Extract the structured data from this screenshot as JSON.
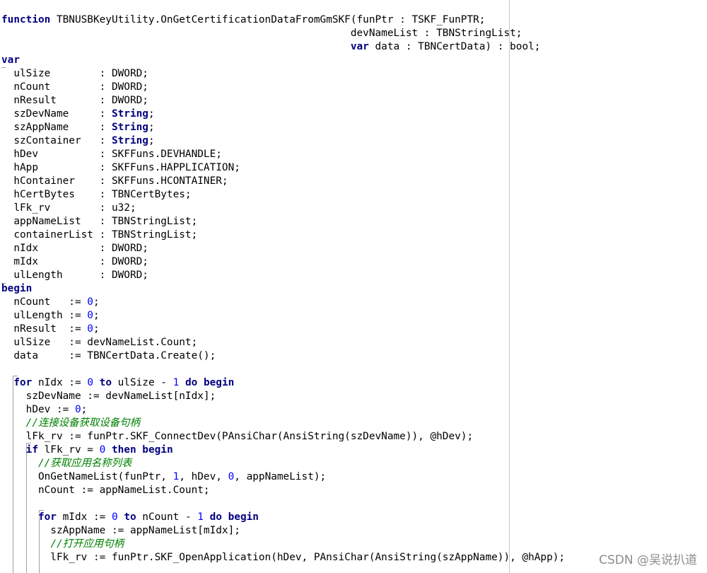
{
  "colors": {
    "keyword": "#000080",
    "number": "#0000ff",
    "comment": "#008000",
    "text": "#000000",
    "background": "#ffffff"
  },
  "watermark": "CSDN @吴说扒道",
  "code_lines": [
    [
      [
        "kw",
        "function"
      ],
      [
        "txt",
        " TBNUSBKeyUtility.OnGetCertificationDataFromGmSKF(funPtr : TSKF_FunPTR;"
      ]
    ],
    [
      [
        "txt",
        "                                                         devNameList : TBNStringList;"
      ]
    ],
    [
      [
        "txt",
        "                                                         "
      ],
      [
        "kw",
        "var"
      ],
      [
        "txt",
        " data : TBNCertData) : bool;"
      ]
    ],
    [
      [
        "kw",
        "var"
      ]
    ],
    [
      [
        "txt",
        "  ulSize        : DWORD;"
      ]
    ],
    [
      [
        "txt",
        "  nCount        : DWORD;"
      ]
    ],
    [
      [
        "txt",
        "  nResult       : DWORD;"
      ]
    ],
    [
      [
        "txt",
        "  szDevName     : "
      ],
      [
        "kw",
        "String"
      ],
      [
        "txt",
        ";"
      ]
    ],
    [
      [
        "txt",
        "  szAppName     : "
      ],
      [
        "kw",
        "String"
      ],
      [
        "txt",
        ";"
      ]
    ],
    [
      [
        "txt",
        "  szContainer   : "
      ],
      [
        "kw",
        "String"
      ],
      [
        "txt",
        ";"
      ]
    ],
    [
      [
        "txt",
        "  hDev          : SKFFuns.DEVHANDLE;"
      ]
    ],
    [
      [
        "txt",
        "  hApp          : SKFFuns.HAPPLICATION;"
      ]
    ],
    [
      [
        "txt",
        "  hContainer    : SKFFuns.HCONTAINER;"
      ]
    ],
    [
      [
        "txt",
        "  hCertBytes    : TBNCertBytes;"
      ]
    ],
    [
      [
        "txt",
        "  lFk_rv        : u32;"
      ]
    ],
    [
      [
        "txt",
        "  appNameList   : TBNStringList;"
      ]
    ],
    [
      [
        "txt",
        "  containerList : TBNStringList;"
      ]
    ],
    [
      [
        "txt",
        "  nIdx          : DWORD;"
      ]
    ],
    [
      [
        "txt",
        "  mIdx          : DWORD;"
      ]
    ],
    [
      [
        "txt",
        "  ulLength      : DWORD;"
      ]
    ],
    [
      [
        "kw",
        "begin"
      ]
    ],
    [
      [
        "txt",
        "  nCount   := "
      ],
      [
        "num",
        "0"
      ],
      [
        "txt",
        ";"
      ]
    ],
    [
      [
        "txt",
        "  ulLength := "
      ],
      [
        "num",
        "0"
      ],
      [
        "txt",
        ";"
      ]
    ],
    [
      [
        "txt",
        "  nResult  := "
      ],
      [
        "num",
        "0"
      ],
      [
        "txt",
        ";"
      ]
    ],
    [
      [
        "txt",
        "  ulSize   := devNameList.Count;"
      ]
    ],
    [
      [
        "txt",
        "  data     := TBNCertData.Create();"
      ]
    ],
    [
      [
        "txt",
        ""
      ]
    ],
    [
      [
        "txt",
        "  "
      ],
      [
        "kw",
        "for"
      ],
      [
        "txt",
        " nIdx := "
      ],
      [
        "num",
        "0"
      ],
      [
        "txt",
        " "
      ],
      [
        "kw",
        "to"
      ],
      [
        "txt",
        " ulSize - "
      ],
      [
        "num",
        "1"
      ],
      [
        "txt",
        " "
      ],
      [
        "kw",
        "do"
      ],
      [
        "txt",
        " "
      ],
      [
        "kw",
        "begin"
      ]
    ],
    [
      [
        "txt",
        "    szDevName := devNameList[nIdx];"
      ]
    ],
    [
      [
        "txt",
        "    hDev := "
      ],
      [
        "num",
        "0"
      ],
      [
        "txt",
        ";"
      ]
    ],
    [
      [
        "txt",
        "    "
      ],
      [
        "com",
        "//连接设备获取设备句柄"
      ]
    ],
    [
      [
        "txt",
        "    lFk_rv := funPtr.SKF_ConnectDev(PAnsiChar(AnsiString(szDevName)), @hDev);"
      ]
    ],
    [
      [
        "txt",
        "    "
      ],
      [
        "kw",
        "if"
      ],
      [
        "txt",
        " lFk_rv = "
      ],
      [
        "num",
        "0"
      ],
      [
        "txt",
        " "
      ],
      [
        "kw",
        "then"
      ],
      [
        "txt",
        " "
      ],
      [
        "kw",
        "begin"
      ]
    ],
    [
      [
        "txt",
        "      "
      ],
      [
        "com",
        "//获取应用名称列表"
      ]
    ],
    [
      [
        "txt",
        "      OnGetNameList(funPtr, "
      ],
      [
        "num",
        "1"
      ],
      [
        "txt",
        ", hDev, "
      ],
      [
        "num",
        "0"
      ],
      [
        "txt",
        ", appNameList);"
      ]
    ],
    [
      [
        "txt",
        "      nCount := appNameList.Count;"
      ]
    ],
    [
      [
        "txt",
        ""
      ]
    ],
    [
      [
        "txt",
        "      "
      ],
      [
        "kw",
        "for"
      ],
      [
        "txt",
        " mIdx := "
      ],
      [
        "num",
        "0"
      ],
      [
        "txt",
        " "
      ],
      [
        "kw",
        "to"
      ],
      [
        "txt",
        " nCount - "
      ],
      [
        "num",
        "1"
      ],
      [
        "txt",
        " "
      ],
      [
        "kw",
        "do"
      ],
      [
        "txt",
        " "
      ],
      [
        "kw",
        "begin"
      ]
    ],
    [
      [
        "txt",
        "        szAppName := appNameList[mIdx];"
      ]
    ],
    [
      [
        "txt",
        "        "
      ],
      [
        "com",
        "//打开应用句柄"
      ]
    ],
    [
      [
        "txt",
        "        lFk_rv := funPtr.SKF_OpenApplication(hDev, PAnsiChar(AnsiString(szAppName)), @hApp);"
      ]
    ]
  ]
}
